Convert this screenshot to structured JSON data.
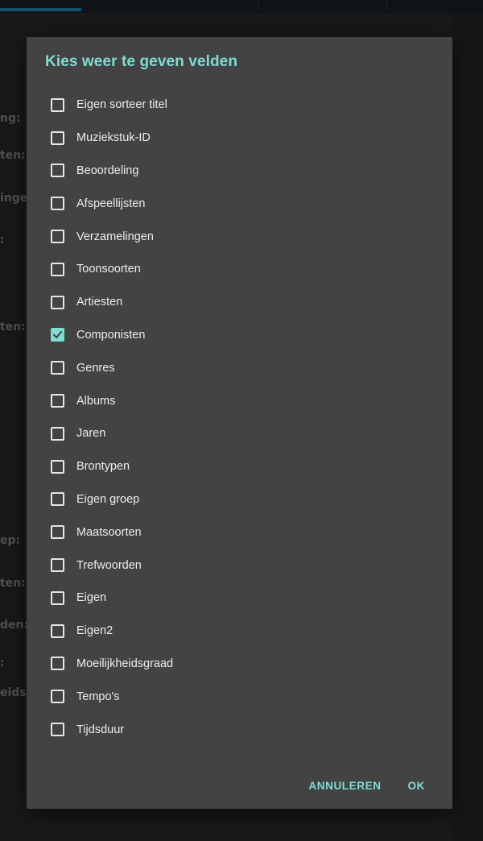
{
  "background": {
    "labels": [
      "ng:",
      "ten:",
      "ingen",
      ":",
      "ten:",
      "ep:",
      "ten:",
      "den:",
      ":",
      "eidsgr"
    ]
  },
  "dialog": {
    "title": "Kies weer te geven velden",
    "options": [
      {
        "label": "Eigen sorteer titel",
        "checked": false
      },
      {
        "label": "Muziekstuk-ID",
        "checked": false
      },
      {
        "label": "Beoordeling",
        "checked": false
      },
      {
        "label": "Afspeellijsten",
        "checked": false
      },
      {
        "label": "Verzamelingen",
        "checked": false
      },
      {
        "label": "Toonsoorten",
        "checked": false
      },
      {
        "label": "Artiesten",
        "checked": false
      },
      {
        "label": "Componisten",
        "checked": true
      },
      {
        "label": "Genres",
        "checked": false
      },
      {
        "label": "Albums",
        "checked": false
      },
      {
        "label": "Jaren",
        "checked": false
      },
      {
        "label": "Brontypen",
        "checked": false
      },
      {
        "label": "Eigen groep",
        "checked": false
      },
      {
        "label": "Maatsoorten",
        "checked": false
      },
      {
        "label": "Trefwoorden",
        "checked": false
      },
      {
        "label": "Eigen",
        "checked": false
      },
      {
        "label": "Eigen2",
        "checked": false
      },
      {
        "label": "Moeilijkheidsgraad",
        "checked": false
      },
      {
        "label": "Tempo's",
        "checked": false
      },
      {
        "label": "Tijdsduur",
        "checked": false
      }
    ],
    "cancel_label": "ANNULEREN",
    "ok_label": "OK"
  },
  "colors": {
    "accent": "#7fdcd2",
    "dialog_bg": "#434343"
  }
}
